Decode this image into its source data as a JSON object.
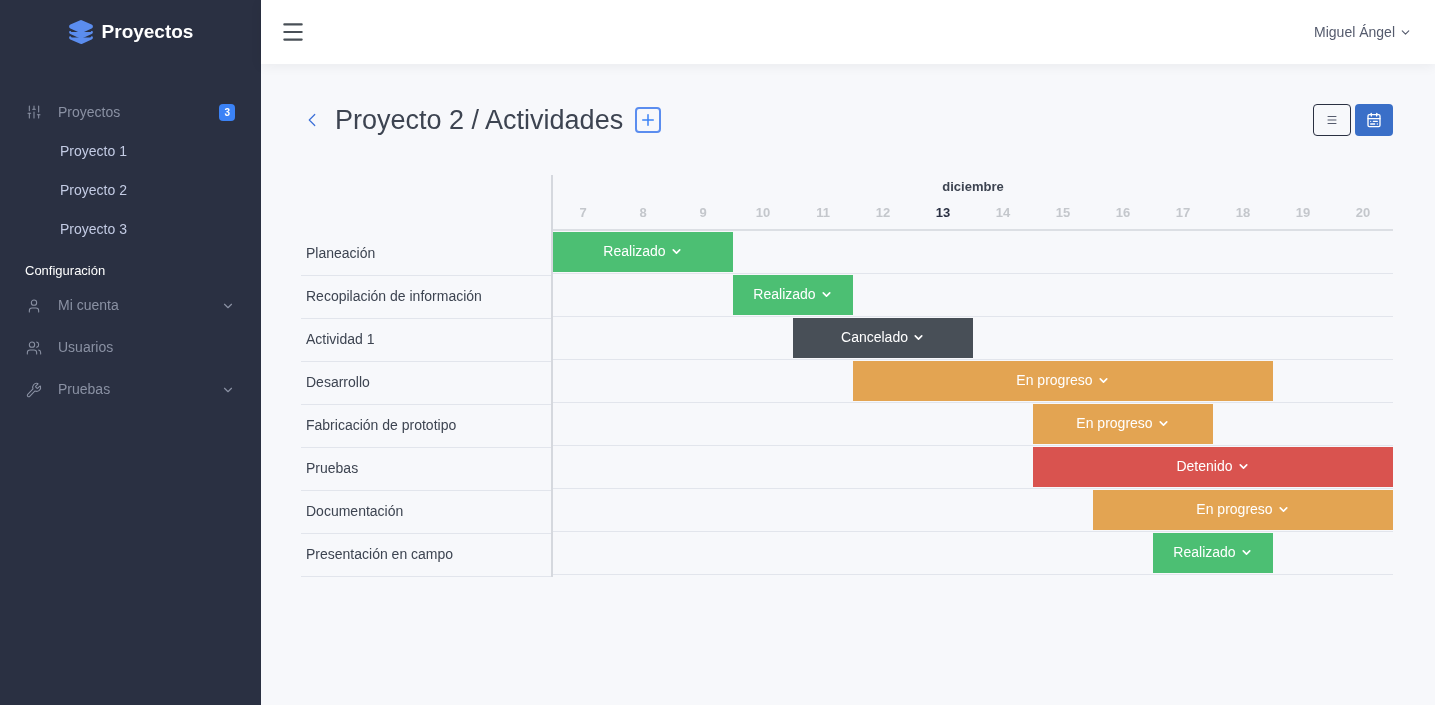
{
  "brand": {
    "name": "Proyectos"
  },
  "sidebar": {
    "items": [
      {
        "kind": "group",
        "label": "Proyectos",
        "badge": "3",
        "children": [
          {
            "label": "Proyecto 1"
          },
          {
            "label": "Proyecto 2"
          },
          {
            "label": "Proyecto 3"
          }
        ]
      },
      {
        "kind": "heading",
        "label": "Configuración"
      },
      {
        "kind": "item",
        "label": "Mi cuenta",
        "expanded": false
      },
      {
        "kind": "item",
        "label": "Usuarios"
      },
      {
        "kind": "item",
        "label": "Pruebas",
        "expanded": false
      }
    ]
  },
  "header": {
    "user": "Miguel Ángel"
  },
  "page": {
    "title": "Proyecto 2 / Actividades",
    "views": [
      {
        "kind": "list",
        "selected": false
      },
      {
        "kind": "calendar",
        "selected": true
      }
    ]
  },
  "gantt": {
    "month": "diciembre",
    "days": [
      {
        "label": "7",
        "today": false
      },
      {
        "label": "8",
        "today": false
      },
      {
        "label": "9",
        "today": false
      },
      {
        "label": "10",
        "today": false
      },
      {
        "label": "11",
        "today": false
      },
      {
        "label": "12",
        "today": false
      },
      {
        "label": "13",
        "today": true
      },
      {
        "label": "14",
        "today": false
      },
      {
        "label": "15",
        "today": false
      },
      {
        "label": "16",
        "today": false
      },
      {
        "label": "17",
        "today": false
      },
      {
        "label": "18",
        "today": false
      },
      {
        "label": "19",
        "today": false
      },
      {
        "label": "20",
        "today": false
      }
    ],
    "rows": [
      {
        "name": "Planeación",
        "scheduled": [
          true,
          true,
          true,
          false,
          false,
          false,
          false,
          false,
          false,
          false,
          false,
          false,
          false,
          false
        ],
        "kind": "done",
        "status": "Realizado"
      },
      {
        "name": "Recopilación de información",
        "scheduled": [
          false,
          false,
          false,
          true,
          true,
          false,
          false,
          false,
          false,
          false,
          false,
          false,
          false,
          false
        ],
        "kind": "done",
        "status": "Realizado"
      },
      {
        "name": "Actividad 1",
        "scheduled": [
          false,
          false,
          false,
          false,
          true,
          true,
          true,
          false,
          false,
          false,
          false,
          false,
          false,
          false
        ],
        "kind": "cancelled",
        "status": "Cancelado"
      },
      {
        "name": "Desarrollo",
        "scheduled": [
          false,
          false,
          false,
          false,
          false,
          true,
          true,
          true,
          true,
          true,
          true,
          true,
          false,
          false
        ],
        "kind": "progress",
        "status": "En progreso"
      },
      {
        "name": "Fabricación de prototipo",
        "scheduled": [
          false,
          false,
          false,
          false,
          false,
          false,
          false,
          false,
          true,
          true,
          true,
          false,
          false,
          false
        ],
        "kind": "progress",
        "status": "En progreso"
      },
      {
        "name": "Pruebas",
        "scheduled": [
          false,
          false,
          false,
          false,
          false,
          false,
          false,
          false,
          true,
          true,
          true,
          true,
          true,
          true
        ],
        "kind": "stopped",
        "status": "Detenido"
      },
      {
        "name": "Documentación",
        "scheduled": [
          false,
          false,
          false,
          false,
          false,
          false,
          false,
          false,
          false,
          true,
          true,
          true,
          true,
          true
        ],
        "kind": "progress",
        "status": "En progreso"
      },
      {
        "name": "Presentación en campo",
        "scheduled": [
          false,
          false,
          false,
          false,
          false,
          false,
          false,
          false,
          false,
          false,
          true,
          true,
          false,
          false
        ],
        "kind": "done",
        "status": "Realizado"
      }
    ]
  }
}
